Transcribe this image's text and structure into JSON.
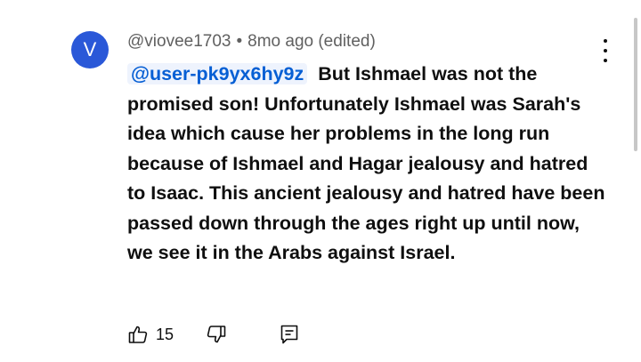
{
  "comment": {
    "avatar_letter": "V",
    "author": "@viovee1703",
    "separator": "•",
    "time": "8mo ago (edited)",
    "mention": "@user-pk9yx6hy9z",
    "text": "But Ishmael was not the promised son! Unfortunately Ishmael was Sarah's idea which cause her problems in the long run because of Ishmael and Hagar jealousy and hatred to Isaac. This ancient jealousy and hatred have been passed down through the ages right up until now, we see it in the Arabs against Israel.",
    "like_count": "15"
  },
  "icons": {
    "more": "more-vertical-icon",
    "like": "thumbs-up-icon",
    "dislike": "thumbs-down-icon",
    "reply": "reply-icon"
  },
  "colors": {
    "avatar_bg": "#2a58d8",
    "link": "#065fd4",
    "meta_text": "#606060"
  }
}
